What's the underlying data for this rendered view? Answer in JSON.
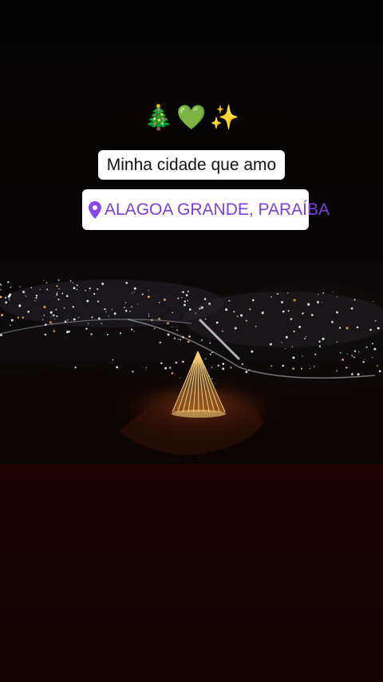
{
  "sticker": {
    "emojis": [
      "🎄",
      "💚",
      "✨"
    ],
    "caption": "Minha cidade que amo",
    "location": "ALAGOA GRANDE, PARAÍBA"
  },
  "icons": {
    "location": "location-pin-icon"
  },
  "colors": {
    "location_text": "#7b3fe0",
    "sticker_bg": "#ffffff",
    "background_bottom": "#1b0302",
    "tree_lights": "#ffb040"
  }
}
